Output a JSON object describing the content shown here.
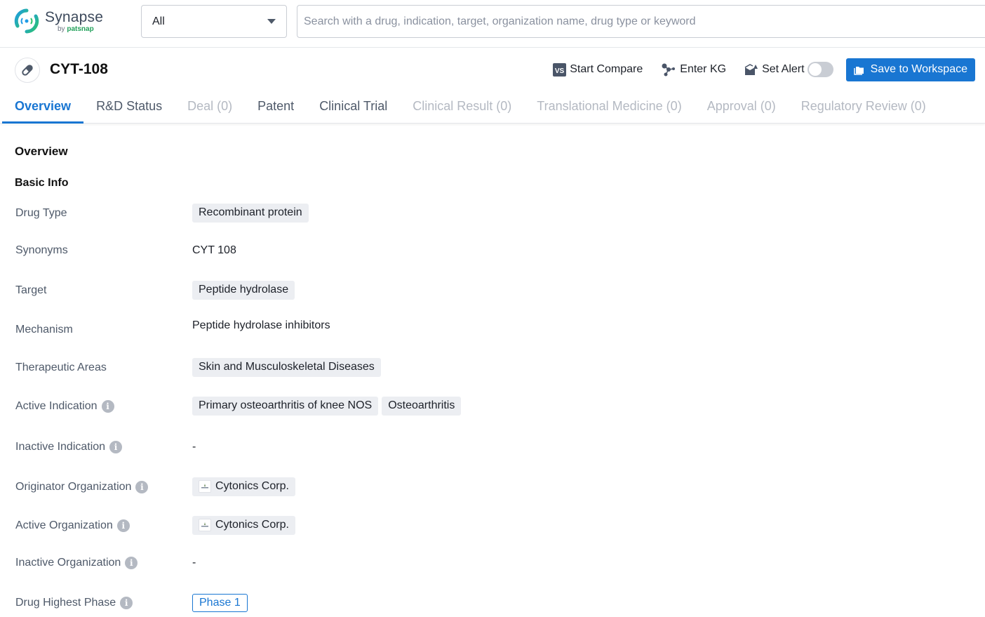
{
  "app": {
    "logo_name": "Synapse",
    "logo_by": "by",
    "logo_brand": "patsnap",
    "brand_color": "#1976d2"
  },
  "search": {
    "scope_value": "All",
    "placeholder": "Search with a drug, indication, target, organization name, drug type or keyword",
    "value": ""
  },
  "drug": {
    "title": "CYT-108",
    "icon": "pill-icon"
  },
  "actions": {
    "compare_label": "Start Compare",
    "kg_label": "Enter KG",
    "alert_label": "Set Alert",
    "alert_enabled": false,
    "save_label": "Save to Workspace"
  },
  "tabs": [
    {
      "label": "Overview",
      "state": "active"
    },
    {
      "label": "R&D Status",
      "state": "enabled"
    },
    {
      "label": "Deal (0)",
      "state": "disabled"
    },
    {
      "label": "Patent",
      "state": "enabled"
    },
    {
      "label": "Clinical Trial",
      "state": "enabled"
    },
    {
      "label": "Clinical Result (0)",
      "state": "disabled"
    },
    {
      "label": "Translational Medicine (0)",
      "state": "disabled"
    },
    {
      "label": "Approval (0)",
      "state": "disabled"
    },
    {
      "label": "Regulatory Review (0)",
      "state": "disabled"
    }
  ],
  "overview": {
    "title": "Overview",
    "basic_info_title": "Basic Info",
    "fields": {
      "drug_type": {
        "label": "Drug Type",
        "chips": [
          "Recombinant protein"
        ]
      },
      "synonyms": {
        "label": "Synonyms",
        "text": "CYT 108"
      },
      "target": {
        "label": "Target",
        "chips": [
          "Peptide hydrolase"
        ]
      },
      "mechanism": {
        "label": "Mechanism",
        "text": "Peptide hydrolase inhibitors"
      },
      "therapeutic_areas": {
        "label": "Therapeutic Areas",
        "chips": [
          "Skin and Musculoskeletal Diseases"
        ]
      },
      "active_indication": {
        "label": "Active Indication",
        "chips": [
          "Primary osteoarthritis of knee NOS",
          "Osteoarthritis"
        ]
      },
      "inactive_indication": {
        "label": "Inactive Indication",
        "text": "-"
      },
      "originator_org": {
        "label": "Originator Organization",
        "orgs": [
          "Cytonics Corp."
        ]
      },
      "active_org": {
        "label": "Active Organization",
        "orgs": [
          "Cytonics Corp."
        ]
      },
      "inactive_org": {
        "label": "Inactive Organization",
        "text": "-"
      },
      "highest_phase": {
        "label": "Drug Highest Phase",
        "phase": "Phase 1"
      }
    }
  }
}
